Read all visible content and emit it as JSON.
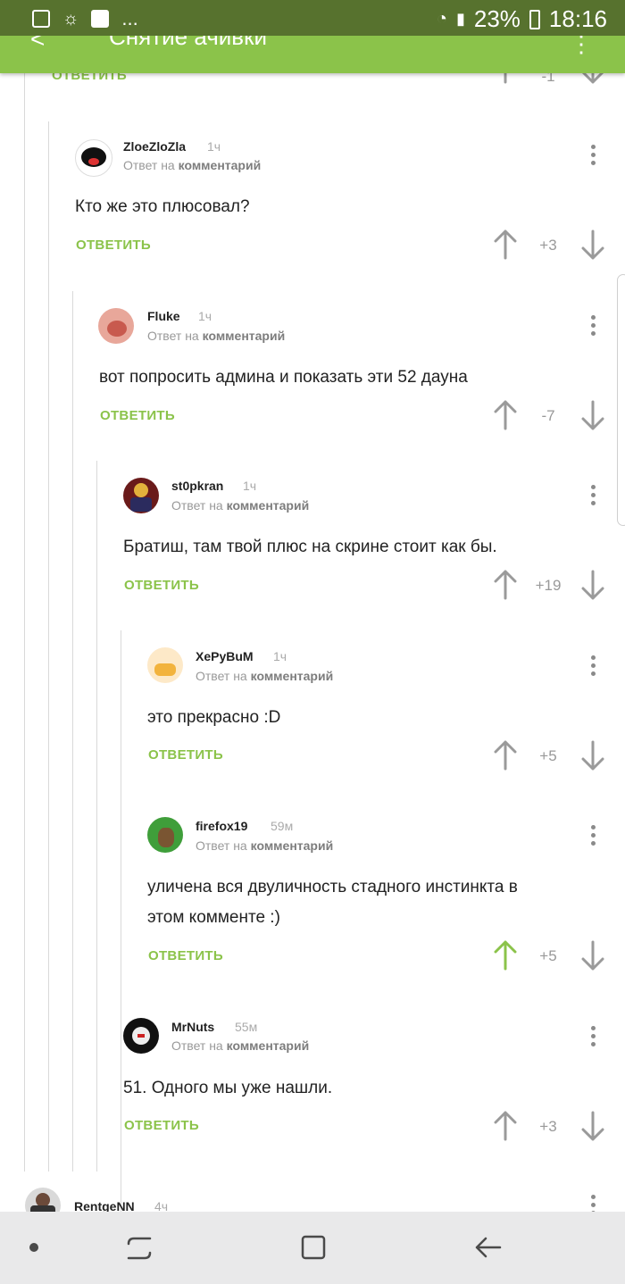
{
  "status_bar": {
    "left_more": "...",
    "battery": "23%",
    "time": "18:16"
  },
  "header": {
    "title": "Снятие ачивки"
  },
  "top_partial": {
    "reply_label": "ОТВЕТИТЬ",
    "score": "-1"
  },
  "comments": [
    {
      "author": "ZloeZloZla",
      "time": "1ч",
      "reply_prefix": "Ответ на",
      "reply_target": "комментарий",
      "text_lines": [
        "Кто же это плюсовал?"
      ],
      "reply_label": "ОТВЕТИТЬ",
      "score": "+3",
      "upvoted": false
    },
    {
      "author": "Fluke",
      "time": "1ч",
      "reply_prefix": "Ответ на",
      "reply_target": "комментарий",
      "text_lines": [
        "вот попросить админа и показать эти 52 дауна"
      ],
      "reply_label": "ОТВЕТИТЬ",
      "score": "-7",
      "upvoted": false
    },
    {
      "author": "st0pkran",
      "time": "1ч",
      "reply_prefix": "Ответ на",
      "reply_target": "комментарий",
      "text_lines": [
        "Братиш, там твой плюс на скрине стоит как бы."
      ],
      "reply_label": "ОТВЕТИТЬ",
      "score": "+19",
      "upvoted": false
    },
    {
      "author": "XePyBuM",
      "time": "1ч",
      "reply_prefix": "Ответ на",
      "reply_target": "комментарий",
      "text_lines": [
        "это прекрасно :D"
      ],
      "reply_label": "ОТВЕТИТЬ",
      "score": "+5",
      "upvoted": false
    },
    {
      "author": "firefox19",
      "time": "59м",
      "reply_prefix": "Ответ на",
      "reply_target": "комментарий",
      "text_lines": [
        "уличена вся двуличность стадного инстинкта в",
        "этом комменте :)"
      ],
      "reply_label": "ОТВЕТИТЬ",
      "score": "+5",
      "upvoted": true
    },
    {
      "author": "MrNuts",
      "time": "55м",
      "reply_prefix": "Ответ на",
      "reply_target": "комментарий",
      "text_lines": [
        "51. Одного мы уже нашли."
      ],
      "reply_label": "ОТВЕТИТЬ",
      "score": "+3",
      "upvoted": false
    }
  ],
  "next_comment": {
    "author": "RentgeNN",
    "time": "4ч"
  },
  "colors": {
    "status_bar": "#57722e",
    "header": "#8bc34a",
    "accent_green": "#8bc34a",
    "text": "#222222",
    "muted": "#999999"
  },
  "icons": {
    "upvote": "arrow-up-icon",
    "downvote": "arrow-down-icon",
    "more": "more-vertical-icon"
  }
}
